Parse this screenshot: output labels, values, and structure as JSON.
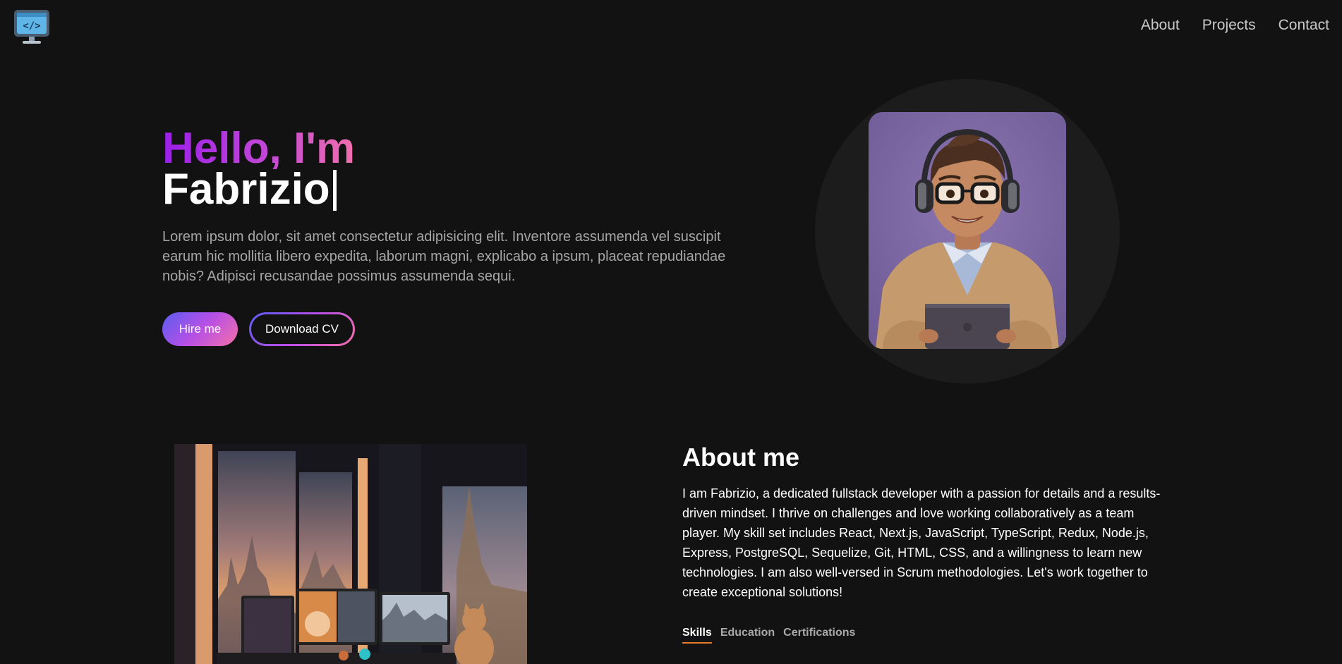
{
  "nav": {
    "logo_icon": "computer-code-icon",
    "items": [
      "About",
      "Projects",
      "Contact"
    ]
  },
  "hero": {
    "greeting": "Hello, I'm",
    "name": "Fabrizio",
    "description": "Lorem ipsum dolor, sit amet consectetur adipisicing elit. Inventore assumenda vel suscipit earum hic mollitia libero expedita, laborum magni, explicabo a ipsum, placeat repudiandae nobis? Adipisci recusandae possimus assumenda sequi.",
    "hire_button": "Hire me",
    "cv_button": "Download CV"
  },
  "about": {
    "title": "About me",
    "text": "I am Fabrizio, a dedicated fullstack developer with a passion for details and a results-driven mindset. I thrive on challenges and love working collaboratively as a team player. My skill set includes React, Next.js, JavaScript, TypeScript, Redux, Node.js, Express, PostgreSQL, Sequelize, Git, HTML, CSS, and a willingness to learn new technologies. I am also well-versed in Scrum methodologies. Let's work together to create exceptional solutions!",
    "tabs": [
      "Skills",
      "Education",
      "Certifications"
    ],
    "active_tab": "Skills"
  },
  "colors": {
    "background": "#121212",
    "gradient_start": "#5a5cf2",
    "gradient_mid": "#b650e6",
    "gradient_end": "#f46fa8",
    "tab_underline": "#e77c2d"
  }
}
